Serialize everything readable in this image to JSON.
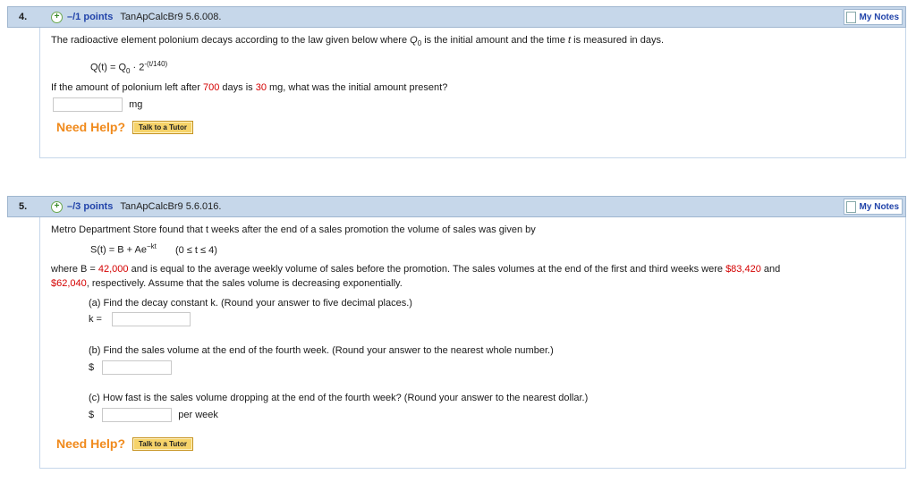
{
  "q4": {
    "number": "4.",
    "points": "–/1 points",
    "code": "TanApCalcBr9 5.6.008.",
    "my_notes": "My Notes",
    "text1_a": "The radioactive element polonium decays according to the law given below where ",
    "text1_q": "Q",
    "text1_q_sub": "0",
    "text1_b": " is the initial amount and the time ",
    "text1_t": "t",
    "text1_c": " is measured in days.",
    "formula_lhs": "Q(t) = Q",
    "formula_sub": "0",
    "formula_mid": " · 2",
    "formula_sup": "-(t/140)",
    "question_a": "If the amount of polonium left after ",
    "days": "700",
    "question_b": " days is ",
    "mg_value": "30",
    "question_c": " mg, what was the initial amount present?",
    "unit": "mg",
    "need_help": "Need Help?",
    "tutor": "Talk to a Tutor"
  },
  "q5": {
    "number": "5.",
    "points": "–/3 points",
    "code": "TanApCalcBr9 5.6.016.",
    "my_notes": "My Notes",
    "intro": "Metro Department Store found that t weeks after the end of a sales promotion the volume of sales was given by",
    "formula_lhs": "S(t) = B + Ae",
    "formula_sup": "−kt",
    "formula_domain": "(0 ≤ t ≤ 4)",
    "where_a": "where B = ",
    "b_value": "42,000",
    "where_b": " and is equal to the average weekly volume of sales before the promotion. The sales volumes at the end of the first and third weeks were ",
    "sales1": "$83,420",
    "where_c": " and",
    "sales3": "$62,040",
    "where_d": ", respectively. Assume that the sales volume is decreasing exponentially.",
    "part_a": "(a) Find the decay constant k. (Round your answer to five decimal places.)",
    "k_label": "k =",
    "part_b": "(b) Find the sales volume at the end of the fourth week. (Round your answer to the nearest whole number.)",
    "dollar": "$",
    "part_c": "(c) How fast is the sales volume dropping at the end of the fourth week? (Round your answer to the nearest dollar.)",
    "per_week": "per week",
    "need_help": "Need Help?",
    "tutor": "Talk to a Tutor"
  }
}
